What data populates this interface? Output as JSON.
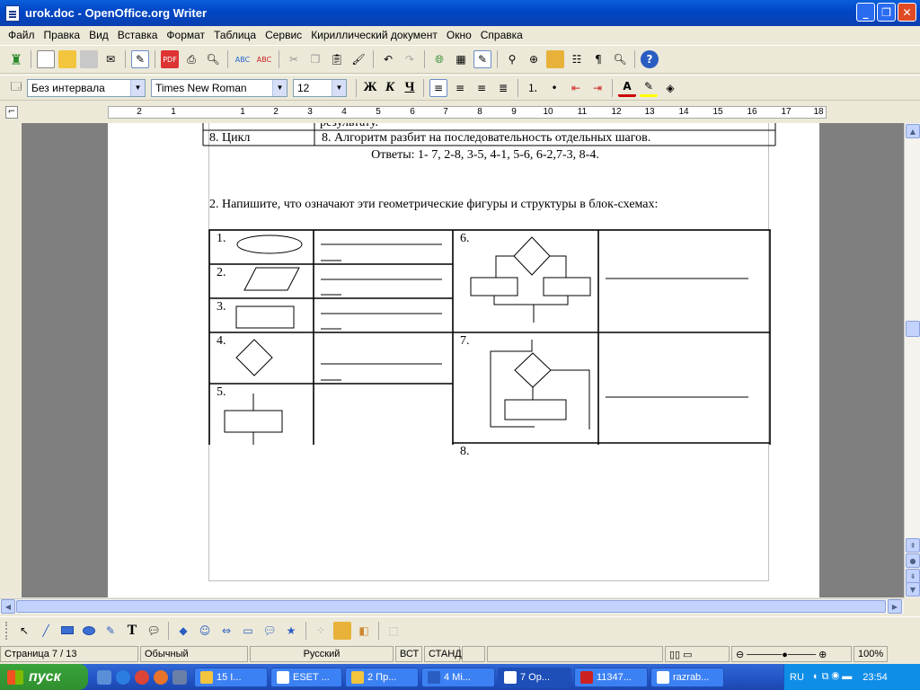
{
  "window": {
    "title": "urok.doc - OpenOffice.org Writer",
    "buttons": [
      "_",
      "❐",
      "✕"
    ]
  },
  "menu": [
    "Файл",
    "Правка",
    "Вид",
    "Вставка",
    "Формат",
    "Таблица",
    "Сервис",
    "Кириллический документ",
    "Окно",
    "Справка"
  ],
  "format_toolbar": {
    "style": "Без интервала",
    "font": "Times New Roman",
    "size": "12",
    "bold": "Ж",
    "italic": "К",
    "underline": "Ч"
  },
  "ruler": {
    "numbers": [
      "2",
      "1",
      "1",
      "2",
      "3",
      "4",
      "5",
      "6",
      "7",
      "8",
      "9",
      "10",
      "11",
      "12",
      "13",
      "14",
      "15",
      "16",
      "17",
      "18"
    ]
  },
  "document": {
    "prev_row_tail": "результату.",
    "row8_left": "8. Цикл",
    "row8_right": "8. Алгоритм разбит на последовательность отдельных шагов.",
    "answers": "Ответы: 1- 7, 2-8, 3-5, 4-1, 5-6, 6-2,7-3, 8-4.",
    "task2": "2. Напишите, что означают эти геометрические фигуры    и структуры в блок-схемах:",
    "labels": [
      "1.",
      "2.",
      "3.",
      "4.",
      "5.",
      "6.",
      "7.",
      "8."
    ]
  },
  "status": {
    "page": "Страница  7 / 13",
    "style": "Обычный",
    "language": "Русский",
    "insert": "ВСТ",
    "select": "СТАНД",
    "zoom": "100%"
  },
  "taskbar": {
    "start": "пуск",
    "tasks": [
      "15 I...",
      "ESET ...",
      "2 Пр...",
      "4 Mi...",
      "7 Op...",
      "11347...",
      "razrab..."
    ],
    "lang": "RU",
    "clock": "23:54"
  }
}
